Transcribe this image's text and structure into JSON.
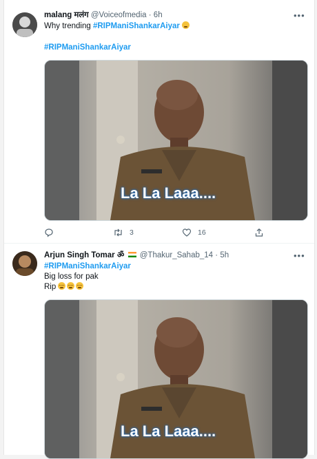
{
  "tweet1": {
    "name": "malang मलंग",
    "handle": "@Voiceofmedia",
    "separator": "·",
    "time": "6h",
    "text_prefix": "Why trending",
    "hashtag": "#RIPManiShankarAiyar",
    "hashtag2": "#RIPManiShankarAiyar",
    "media_caption": "La La Laaa....",
    "reply_count": "",
    "retweet_count": "3",
    "like_count": "16"
  },
  "tweet2": {
    "name": "Arjun Singh Tomar ॐ",
    "handle": "@Thakur_Sahab_14",
    "separator": "·",
    "time": "5h",
    "hashtag": "#RIPManiShankarAiyar",
    "line2": "Big loss for pak",
    "line3": "Rip",
    "media_caption": "La La Laaa...."
  },
  "icons": {
    "more": "more-icon",
    "reply": "reply-icon",
    "retweet": "retweet-icon",
    "like": "like-icon",
    "share": "share-icon"
  },
  "colors": {
    "accent": "#1d9bf0",
    "secondary_text": "#536471"
  }
}
